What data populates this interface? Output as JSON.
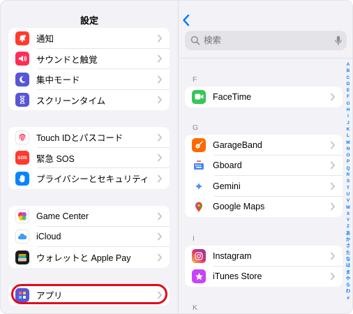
{
  "sidebar": {
    "title": "設定",
    "group1": [
      {
        "label": "通知",
        "icon": "bell-icon",
        "color": "#ff3b30"
      },
      {
        "label": "サウンドと触覚",
        "icon": "speaker-icon",
        "color": "#ff2d55"
      },
      {
        "label": "集中モード",
        "icon": "moon-icon",
        "color": "#5856d6"
      },
      {
        "label": "スクリーンタイム",
        "icon": "hourglass-icon",
        "color": "#5856d6"
      }
    ],
    "group2": [
      {
        "label": "Touch IDとパスコード",
        "icon": "fingerprint-icon",
        "color": "#ffffff"
      },
      {
        "label": "緊急 SOS",
        "icon": "sos-icon",
        "color": "#ff3b30",
        "glyph": "SOS"
      },
      {
        "label": "プライバシーとセキュリティ",
        "icon": "hand-icon",
        "color": "#0a84ff"
      }
    ],
    "group3": [
      {
        "label": "Game Center",
        "icon": "game-center-icon",
        "color": "#ffffff"
      },
      {
        "label": "iCloud",
        "icon": "cloud-icon",
        "color": "#ffffff"
      },
      {
        "label": "ウォレットと Apple Pay",
        "icon": "wallet-icon",
        "color": "#1c1c1e"
      }
    ],
    "group4": [
      {
        "label": "アプリ",
        "icon": "apps-grid-icon",
        "color": "#5856d6"
      }
    ],
    "highlight_color": "#e1091a"
  },
  "apps": {
    "search_placeholder": "検索",
    "sections": [
      {
        "letter": "F",
        "items": [
          {
            "label": "FaceTime",
            "icon": "facetime-icon",
            "color": "#34c759"
          }
        ]
      },
      {
        "letter": "G",
        "items": [
          {
            "label": "GarageBand",
            "icon": "guitar-icon",
            "color": "#ff6a00"
          },
          {
            "label": "Gboard",
            "icon": "gboard-icon",
            "color": "#ffffff"
          },
          {
            "label": "Gemini",
            "icon": "gemini-icon",
            "color": "#ffffff"
          },
          {
            "label": "Google Maps",
            "icon": "maps-pin-icon",
            "color": "#ffffff"
          }
        ]
      },
      {
        "letter": "I",
        "items": [
          {
            "label": "Instagram",
            "icon": "instagram-icon",
            "color": "#d6249f"
          },
          {
            "label": "iTunes Store",
            "icon": "star-icon",
            "color": "#c644fc"
          }
        ]
      },
      {
        "letter": "K",
        "items": []
      }
    ],
    "index_letters": [
      "A",
      "B",
      "C",
      "D",
      "E",
      "F",
      "G",
      "H",
      "I",
      "J",
      "K",
      "L",
      "M",
      "N",
      "O",
      "P",
      "Q",
      "R",
      "S",
      "T",
      "U",
      "V",
      "W",
      "X",
      "Y",
      "Z",
      "あ",
      "か",
      "さ",
      "た",
      "な",
      "は",
      "ま",
      "や",
      "ら",
      "わ",
      "#"
    ],
    "accent": "#0a7aff"
  }
}
